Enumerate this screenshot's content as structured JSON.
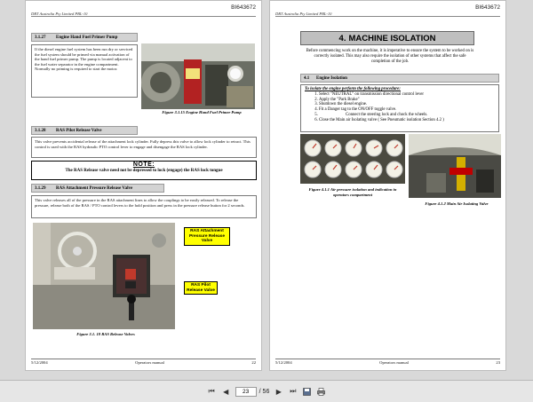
{
  "left_page": {
    "page_id": "BI643672",
    "company": "DBT Australia Pty Limited PBL-10",
    "s1_num": "3.1.27",
    "s1_title": "Engine Hand Fuel Primer Pump",
    "s1_text": "If the diesel engine fuel system has been run dry or serviced the fuel system should be primed via manual activation of the hand fuel primer pump. The pump is located adjacent to the fuel water separator in the engine compartment. Normally no priming is required to start the motor.",
    "s1_caption": "Figure 3.1.15 Engine Hand Fuel Primer Pump",
    "s2_num": "3.1.28",
    "s2_title": "RAS Pilot Release Valve",
    "s2_text": "This valve prevents accidental release of the attachment lock cylinder. Fully depress this valve to allow lock cylinder to retract. This control is used with the RAS hydraulic PTO control lever to engage and disengage the RAS lock cylinder.",
    "note_title": "NOTE:",
    "note_text": "The RAS Release valve need not be depressed to lock (engage) the RAS lock tongue",
    "s3_num": "3.1.29",
    "s3_title": "RAS Attachment Pressure Release Valve",
    "s3_text": "This valve releases all of the pressure in the RAS attachment lines to allow the couplings to be easily released. To release the pressure, release both of the RAS / PTO control levers to the hold position and press in the pressure release button for 2 seconds.",
    "callout1": "RAS Attachment Pressure Release Valve",
    "callout2": "RAS Pilot Release Valve",
    "fig_caption": "Figure 3.1. 18 RAS Release Valves",
    "footer_date": "5/12/2004",
    "footer_title": "Operators manual",
    "footer_page": "22"
  },
  "right_page": {
    "page_id": "BI643672",
    "company": "DBT Australia Pty Limited PBL-10",
    "title_num": "4.",
    "title_text": "MACHINE ISOLATION",
    "intro": "Before commencing work on the machine, it is imperative to ensure the system to be worked on is correctly isolated. This may also require the isolation of other systems that affect the safe completion of the job.",
    "sec_num": "4.1",
    "sec_title": "Engine Isolation",
    "steps_lead": "To isolate the engine perform the following procedure:",
    "steps": [
      "Select \"NEUTRAL\" on transmission directional control lever",
      "Apply the \"Park Brake\"",
      "Shutdown the diesel engine.",
      "Fit a Danger tag to the ON/OFF toggle valve.",
      "Connect the steering lock and chock the wheels.",
      "Close the Main air Isolating valve ( See Pneumatic isolation Section 4.2 )"
    ],
    "fig1_caption": "Figure 4.1.1 Air pressure isolation and indication in operators compartment",
    "fig2_caption": "Figure 4.1.2 Main Air Isolating Valve",
    "footer_date": "5/12/2004",
    "footer_title": "Operators manual",
    "footer_page": "23"
  },
  "toolbar": {
    "current_page": "23",
    "page_total": "/ 56"
  },
  "icons": {
    "first": "first-page-icon",
    "prev": "previous-page-icon",
    "next": "next-page-icon",
    "last": "last-page-icon",
    "save": "save-icon",
    "print": "print-icon"
  }
}
